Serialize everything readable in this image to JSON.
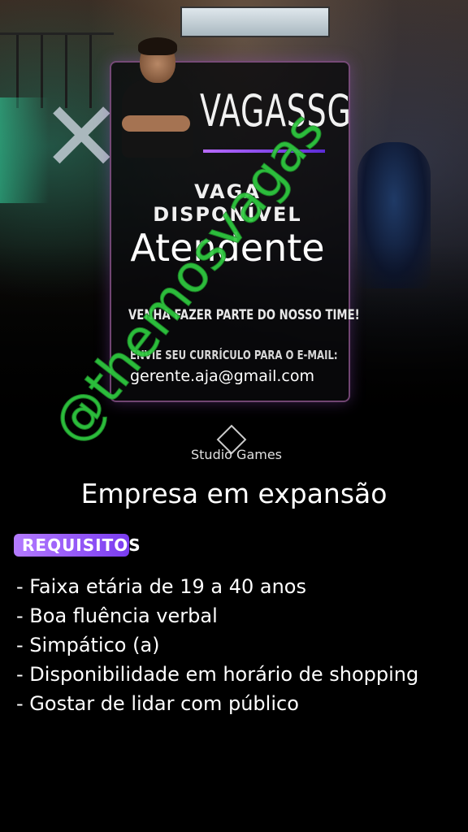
{
  "poster": {
    "brand": "VAGASSG",
    "headline": "VAGA DISPONÍVEL",
    "job_title": "Atendente",
    "invite": "VENHA FAZER PARTE DO NOSSO TIME!",
    "send_cv": "ENVIE SEU CURRÍCULO PARA O E-MAIL:",
    "email": "gerente.aja@gmail.com",
    "studio": "Studio Games",
    "company_note": "Empresa em expansão",
    "requirements_label": "REQUISITOS",
    "requirements": [
      "Faixa etária de 19 a 40 anos",
      "Boa fluência verbal",
      "Simpático (a)",
      "Disponibilidade em horário de shopping",
      "Gostar de lidar com público"
    ]
  },
  "watermark": "@themosvagas",
  "colors": {
    "accent_purple": "#8a4dff",
    "watermark_green": "#2fcc40",
    "background": "#000000",
    "text": "#ffffff"
  }
}
